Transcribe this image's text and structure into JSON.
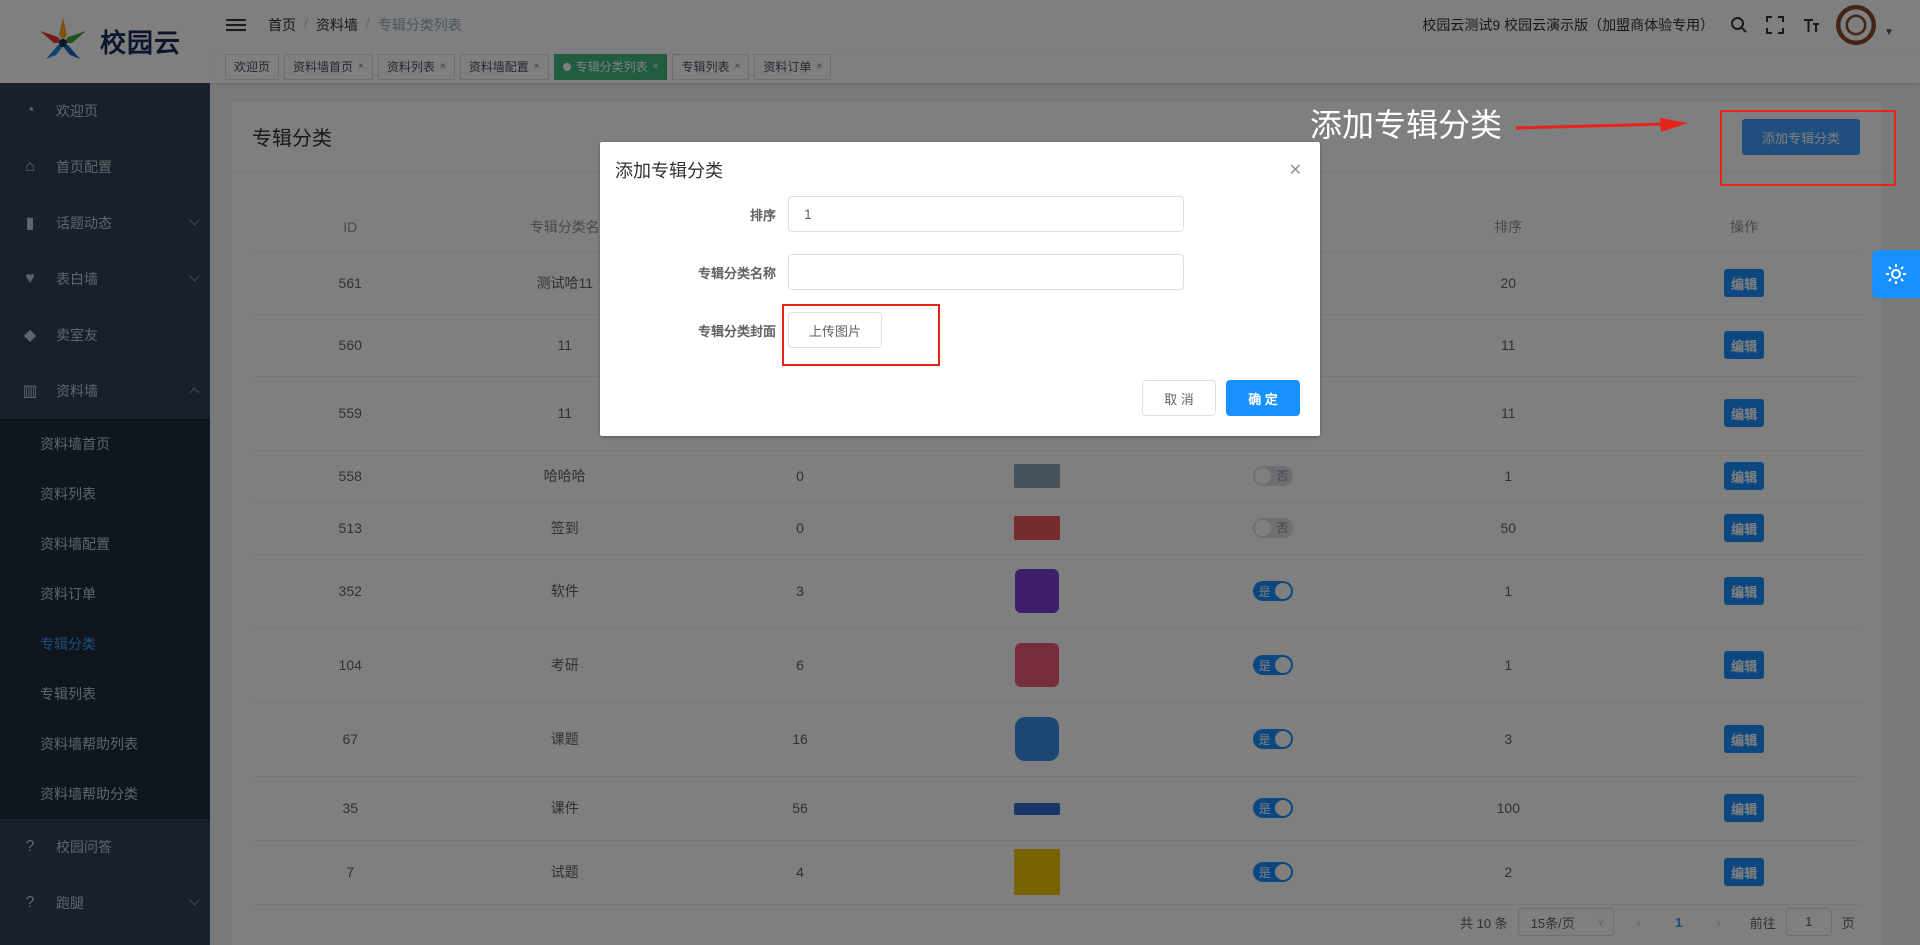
{
  "app": {
    "logo_text": "校园云"
  },
  "sidebar": {
    "items": [
      {
        "label": "欢迎页",
        "icon": "dashboard-icon"
      },
      {
        "label": "首页配置",
        "icon": "home-icon"
      },
      {
        "label": "话题动态",
        "icon": "book-icon"
      },
      {
        "label": "表白墙",
        "icon": "heart-icon"
      },
      {
        "label": "卖室友",
        "icon": "tag-icon"
      },
      {
        "label": "资料墙",
        "icon": "library-icon"
      }
    ],
    "sub_items": [
      "资料墙首页",
      "资料列表",
      "资料墙配置",
      "资料订单",
      "专辑分类",
      "专辑列表",
      "资料墙帮助列表",
      "资料墙帮助分类"
    ],
    "bottom_items": [
      {
        "label": "校园问答",
        "icon": "question-icon"
      },
      {
        "label": "跑腿",
        "icon": "question-icon"
      }
    ]
  },
  "header": {
    "breadcrumb": [
      "首页",
      "资料墙",
      "专辑分类列表"
    ],
    "org_name": "校园云测试9 校园云演示版（加盟商体验专用）"
  },
  "tags": [
    {
      "label": "欢迎页",
      "closable": false,
      "active": false
    },
    {
      "label": "资料墙首页",
      "closable": true,
      "active": false
    },
    {
      "label": "资料列表",
      "closable": true,
      "active": false
    },
    {
      "label": "资料墙配置",
      "closable": true,
      "active": false
    },
    {
      "label": "专辑分类列表",
      "closable": true,
      "active": true
    },
    {
      "label": "专辑列表",
      "closable": true,
      "active": false
    },
    {
      "label": "资料订单",
      "closable": true,
      "active": false
    }
  ],
  "main": {
    "title": "专辑分类",
    "add_button": "添加专辑分类",
    "columns": [
      "ID",
      "专辑分类名",
      "",
      "",
      "",
      "排序",
      "操作"
    ],
    "edit_label": "编辑",
    "rows": [
      {
        "id": "561",
        "name": "测试哈11",
        "count": "",
        "thumb": "",
        "switch": "",
        "sort": "20"
      },
      {
        "id": "560",
        "name": "11",
        "count": "",
        "thumb": "",
        "switch": "",
        "sort": "11"
      },
      {
        "id": "559",
        "name": "11",
        "count": "",
        "thumb": "",
        "switch": "",
        "sort": "11"
      },
      {
        "id": "558",
        "name": "哈哈哈",
        "count": "0",
        "thumb": "#8fa3b8",
        "switch": "否",
        "sort": "1"
      },
      {
        "id": "513",
        "name": "签到",
        "count": "0",
        "thumb": "#e8585a",
        "switch": "否",
        "sort": "50"
      },
      {
        "id": "352",
        "name": "软件",
        "count": "3",
        "thumb": "#7b3fd6",
        "switch": "是",
        "sort": "1"
      },
      {
        "id": "104",
        "name": "考研",
        "count": "6",
        "thumb": "#f05a78",
        "switch": "是",
        "sort": "1"
      },
      {
        "id": "67",
        "name": "课题",
        "count": "16",
        "thumb": "#3a8ee6",
        "switch": "是",
        "sort": "3"
      },
      {
        "id": "35",
        "name": "课件",
        "count": "56",
        "thumb": "#2f6fd1",
        "switch": "是",
        "sort": "100"
      },
      {
        "id": "7",
        "name": "试题",
        "count": "4",
        "thumb": "#f5c400",
        "switch": "是",
        "sort": "2"
      }
    ]
  },
  "pagination": {
    "total": "共 10 条",
    "page_size": "15条/页",
    "current": "1",
    "goto_label": "前往",
    "goto_value": "1",
    "page_suffix": "页"
  },
  "dialog": {
    "title": "添加专辑分类",
    "fields": {
      "sort_label": "排序",
      "sort_value": "1",
      "name_label": "专辑分类名称",
      "name_value": "",
      "cover_label": "专辑分类封面",
      "upload_label": "上传图片"
    },
    "cancel": "取 消",
    "confirm": "确 定"
  },
  "annotation": {
    "text": "添加专辑分类"
  },
  "colors": {
    "primary": "#1890ff",
    "sidebar": "#304156",
    "annotation": "#e5231b",
    "active_tag": "#42b983"
  }
}
